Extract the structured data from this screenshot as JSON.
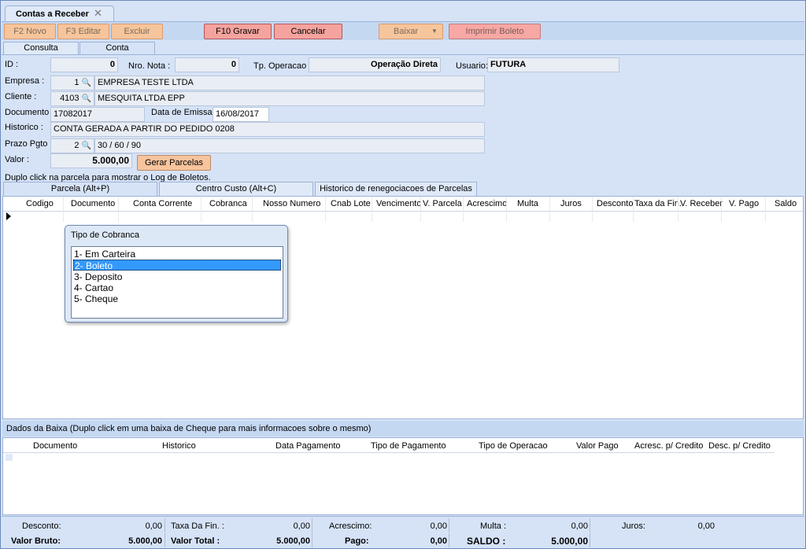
{
  "window": {
    "tab_title": "Contas a Receber",
    "close_glyph": "✕"
  },
  "toolbar": {
    "novo": "F2 Novo",
    "editar": "F3 Editar",
    "excluir": "Excluir",
    "gravar": "F10 Gravar",
    "cancelar": "Cancelar",
    "baixar": "Baixar",
    "imprimir": "Imprimir Boleto"
  },
  "tabs": {
    "consulta": "Consulta",
    "conta": "Conta"
  },
  "form": {
    "id_label": "ID :",
    "id_value": "0",
    "nro_nota_label": "Nro. Nota :",
    "nro_nota_value": "0",
    "tp_operacao_label": "Tp. Operacao :",
    "tp_operacao_value": "Operação Direta",
    "usuario_label": "Usuario:",
    "usuario_value": "FUTURA",
    "empresa_label": "Empresa :",
    "empresa_code": "1",
    "empresa_name": "EMPRESA TESTE LTDA",
    "cliente_label": "Cliente :",
    "cliente_code": "4103",
    "cliente_name": "MESQUITA LTDA EPP",
    "documento_label": "Documento :",
    "documento_value": "17082017",
    "data_emissao_label": "Data de Emissao",
    "data_emissao_value": "16/08/2017",
    "historico_label": "Historico :",
    "historico_value": "CONTA GERADA A PARTIR DO PEDIDO 0208",
    "prazo_label": "Prazo Pgto :",
    "prazo_code": "2",
    "prazo_value": "30 / 60 / 90",
    "valor_label": "Valor :",
    "valor_value": "5.000,00",
    "gerar_parcelas": "Gerar Parcelas",
    "hint": "Duplo click na parcela para mostrar o Log de Boletos."
  },
  "subtabs": {
    "parcela": "Parcela (Alt+P)",
    "centro_custo": "Centro Custo (Alt+C)",
    "historico": "Historico de renegociacoes de Parcelas"
  },
  "parcela_columns": [
    "Codigo",
    "Documento",
    "Conta Corrente",
    "Cobranca",
    "Nosso Numero",
    "Cnab Lote",
    "Vencimento",
    "V. Parcela",
    "Acrescimo",
    "Multa",
    "Juros",
    "Desconto",
    "Taxa da Fin.",
    "V. Receber",
    "V. Pago",
    "Saldo"
  ],
  "popup": {
    "title": "Tipo de Cobranca",
    "options": [
      "1- Em Carteira",
      "2- Boleto",
      "3- Deposito",
      "4- Cartao",
      "5- Cheque"
    ],
    "selected_index": 1
  },
  "baixa": {
    "header": "Dados da Baixa (Duplo click em uma baixa de Cheque para mais informacoes sobre o mesmo)",
    "columns": [
      "Documento",
      "Historico",
      "Data Pagamento",
      "Tipo de Pagamento",
      "Tipo de Operacao",
      "Valor Pago",
      "Acresc. p/ Credito",
      "Desc. p/ Credito"
    ]
  },
  "totals": {
    "desconto_label": "Desconto:",
    "desconto_value": "0,00",
    "taxa_label": "Taxa Da Fin. :",
    "taxa_value": "0,00",
    "acrescimo_label": "Acrescimo:",
    "acrescimo_value": "0,00",
    "multa_label": "Multa :",
    "multa_value": "0,00",
    "juros_label": "Juros:",
    "juros_value": "0,00",
    "valor_bruto_label": "Valor Bruto:",
    "valor_bruto_value": "5.000,00",
    "valor_total_label": "Valor Total :",
    "valor_total_value": "5.000,00",
    "pago_label": "Pago:",
    "pago_value": "0,00",
    "saldo_label": "SALDO :",
    "saldo_value": "5.000,00"
  },
  "colors": {
    "accent_selected": "#3399ff",
    "button_active": "#f5a39e",
    "panel": "#d6e3f7"
  },
  "icons": {
    "lookup": "magnifier-icon",
    "dropdown": "chevron-down-icon",
    "row_indicator": "triangle-right-icon"
  }
}
